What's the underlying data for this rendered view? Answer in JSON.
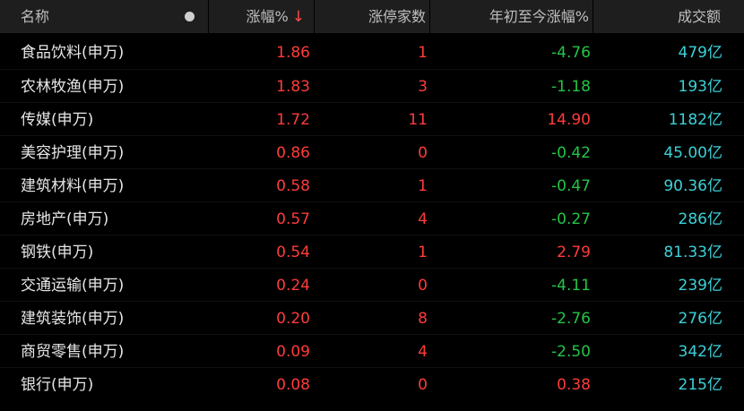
{
  "header": {
    "name": "名称",
    "dot_icon": "circle-icon",
    "pct": "涨幅%",
    "sort_indicator": "↓",
    "limit_up": "涨停家数",
    "ytd": "年初至今涨幅%",
    "volume": "成交额"
  },
  "colors": {
    "up": "#ff3b3b",
    "down": "#24c446",
    "volume": "#3cd1d8",
    "name": "#e6e6e6",
    "header_bg": "#1e1e1e",
    "background": "#000000"
  },
  "rows": [
    {
      "name": "食品饮料(申万)",
      "pct": "1.86",
      "limit_up": "1",
      "ytd": "-4.76",
      "ytd_dir": "neg",
      "volume": "479亿"
    },
    {
      "name": "农林牧渔(申万)",
      "pct": "1.83",
      "limit_up": "3",
      "ytd": "-1.18",
      "ytd_dir": "neg",
      "volume": "193亿"
    },
    {
      "name": "传媒(申万)",
      "pct": "1.72",
      "limit_up": "11",
      "ytd": "14.90",
      "ytd_dir": "pos",
      "volume": "1182亿"
    },
    {
      "name": "美容护理(申万)",
      "pct": "0.86",
      "limit_up": "0",
      "ytd": "-0.42",
      "ytd_dir": "neg",
      "volume": "45.00亿"
    },
    {
      "name": "建筑材料(申万)",
      "pct": "0.58",
      "limit_up": "1",
      "ytd": "-0.47",
      "ytd_dir": "neg",
      "volume": "90.36亿"
    },
    {
      "name": "房地产(申万)",
      "pct": "0.57",
      "limit_up": "4",
      "ytd": "-0.27",
      "ytd_dir": "neg",
      "volume": "286亿"
    },
    {
      "name": "钢铁(申万)",
      "pct": "0.54",
      "limit_up": "1",
      "ytd": "2.79",
      "ytd_dir": "pos",
      "volume": "81.33亿"
    },
    {
      "name": "交通运输(申万)",
      "pct": "0.24",
      "limit_up": "0",
      "ytd": "-4.11",
      "ytd_dir": "neg",
      "volume": "239亿"
    },
    {
      "name": "建筑装饰(申万)",
      "pct": "0.20",
      "limit_up": "8",
      "ytd": "-2.76",
      "ytd_dir": "neg",
      "volume": "276亿"
    },
    {
      "name": "商贸零售(申万)",
      "pct": "0.09",
      "limit_up": "4",
      "ytd": "-2.50",
      "ytd_dir": "neg",
      "volume": "342亿"
    },
    {
      "name": "银行(申万)",
      "pct": "0.08",
      "limit_up": "0",
      "ytd": "0.38",
      "ytd_dir": "pos",
      "volume": "215亿"
    }
  ]
}
